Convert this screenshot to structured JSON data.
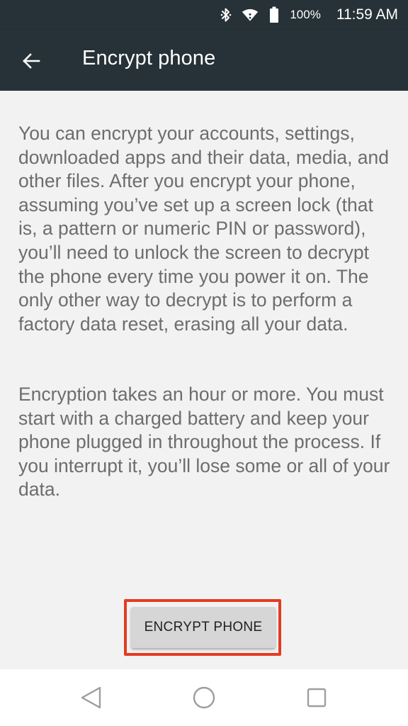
{
  "status_bar": {
    "battery_percent": "100%",
    "time": "11:59 AM",
    "icons": [
      "bluetooth-icon",
      "wifi-icon",
      "battery-icon"
    ]
  },
  "app_bar": {
    "title": "Encrypt phone",
    "back_icon": "arrow-back-icon"
  },
  "content": {
    "paragraph_1": "You can encrypt your accounts, settings, downloaded apps and their data, media, and other files. After you encrypt your phone, assuming you’ve set up a screen lock (that is, a pattern or numeric PIN or password), you’ll need to unlock the screen to decrypt the phone every time you power it on. The only other way to decrypt is to perform a factory data reset, erasing all your data.",
    "paragraph_2": "Encryption takes an hour or more. You must start with a charged battery and keep your phone plugged in throughout the process. If you interrupt it, you’ll lose some or all of your data.",
    "button_label": "ENCRYPT PHONE"
  },
  "nav_bar": {
    "icons": [
      "nav-back-icon",
      "nav-home-icon",
      "nav-recents-icon"
    ]
  },
  "colors": {
    "app_bar": "#263238",
    "background": "#f2f2f2",
    "body_text": "#6d6d6d",
    "highlight": "#e33b22",
    "button": "#d6d6d6"
  }
}
